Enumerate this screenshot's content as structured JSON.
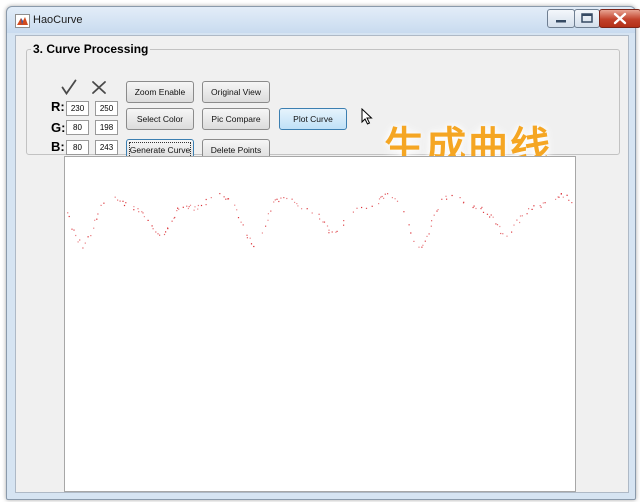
{
  "window": {
    "title": "HaoCurve",
    "app_icon": "matlab-icon"
  },
  "panel": {
    "title": "3. Curve Processing"
  },
  "toolbar": {
    "accept_icon": "check-icon",
    "reject_icon": "x-icon"
  },
  "rgb": {
    "r_label": "R:",
    "g_label": "G:",
    "b_label": "B:",
    "r_min": "230",
    "r_max": "250",
    "g_min": "80",
    "g_max": "198",
    "b_min": "80",
    "b_max": "243"
  },
  "buttons": {
    "zoom_enable": "Zoom Enable",
    "original_view": "Original View",
    "select_color": "Select Color",
    "pic_compare": "Pic Compare",
    "plot_curve": "Plot Curve",
    "generate_curve": "Generate Curve",
    "delete_points": "Delete Points"
  },
  "overlay": {
    "caption": "生成曲线"
  },
  "colors": {
    "curve_points": "#d8232a",
    "caption": "#f5a623",
    "plot_button": "#bfe1f7"
  }
}
